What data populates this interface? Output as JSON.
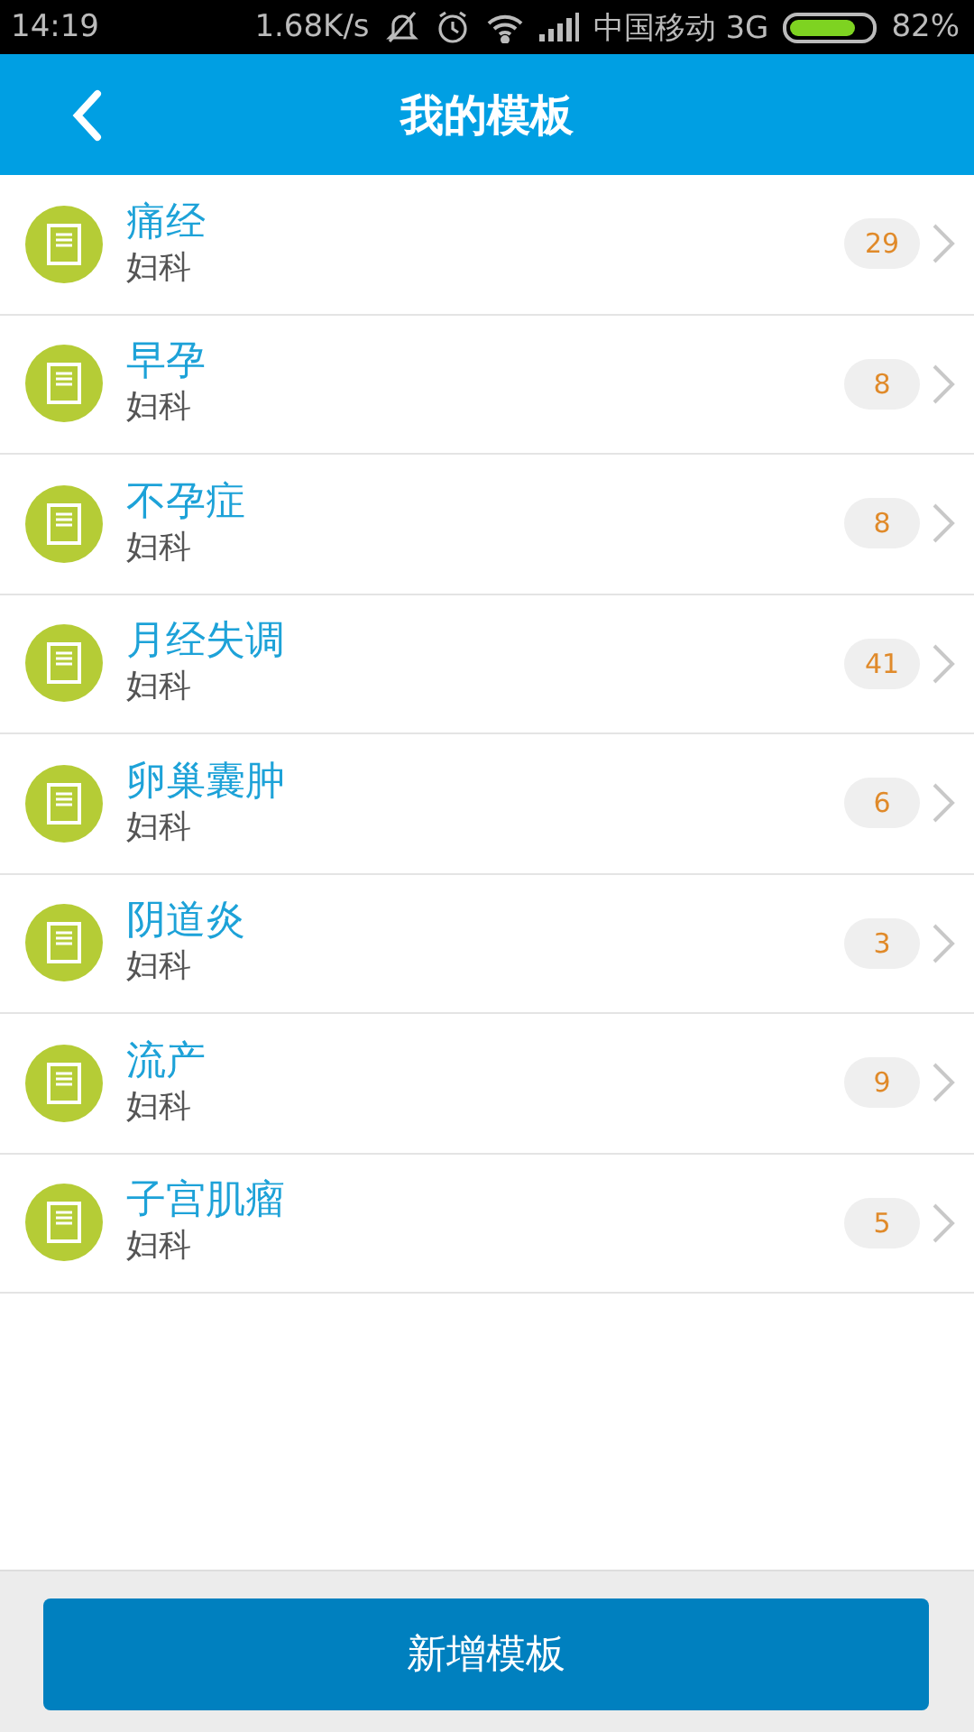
{
  "status_bar": {
    "time": "14:19",
    "speed": "1.68K/s",
    "carrier": "中国移动 3G",
    "battery": "82%"
  },
  "header": {
    "title": "我的模板"
  },
  "templates": [
    {
      "name": "痛经",
      "category": "妇科",
      "count": "29"
    },
    {
      "name": "早孕",
      "category": "妇科",
      "count": "8"
    },
    {
      "name": "不孕症",
      "category": "妇科",
      "count": "8"
    },
    {
      "name": "月经失调",
      "category": "妇科",
      "count": "41"
    },
    {
      "name": "卵巢囊肿",
      "category": "妇科",
      "count": "6"
    },
    {
      "name": "阴道炎",
      "category": "妇科",
      "count": "3"
    },
    {
      "name": "流产",
      "category": "妇科",
      "count": "9"
    },
    {
      "name": "子宫肌瘤",
      "category": "妇科",
      "count": "5"
    }
  ],
  "add_button": {
    "label": "新增模板"
  }
}
